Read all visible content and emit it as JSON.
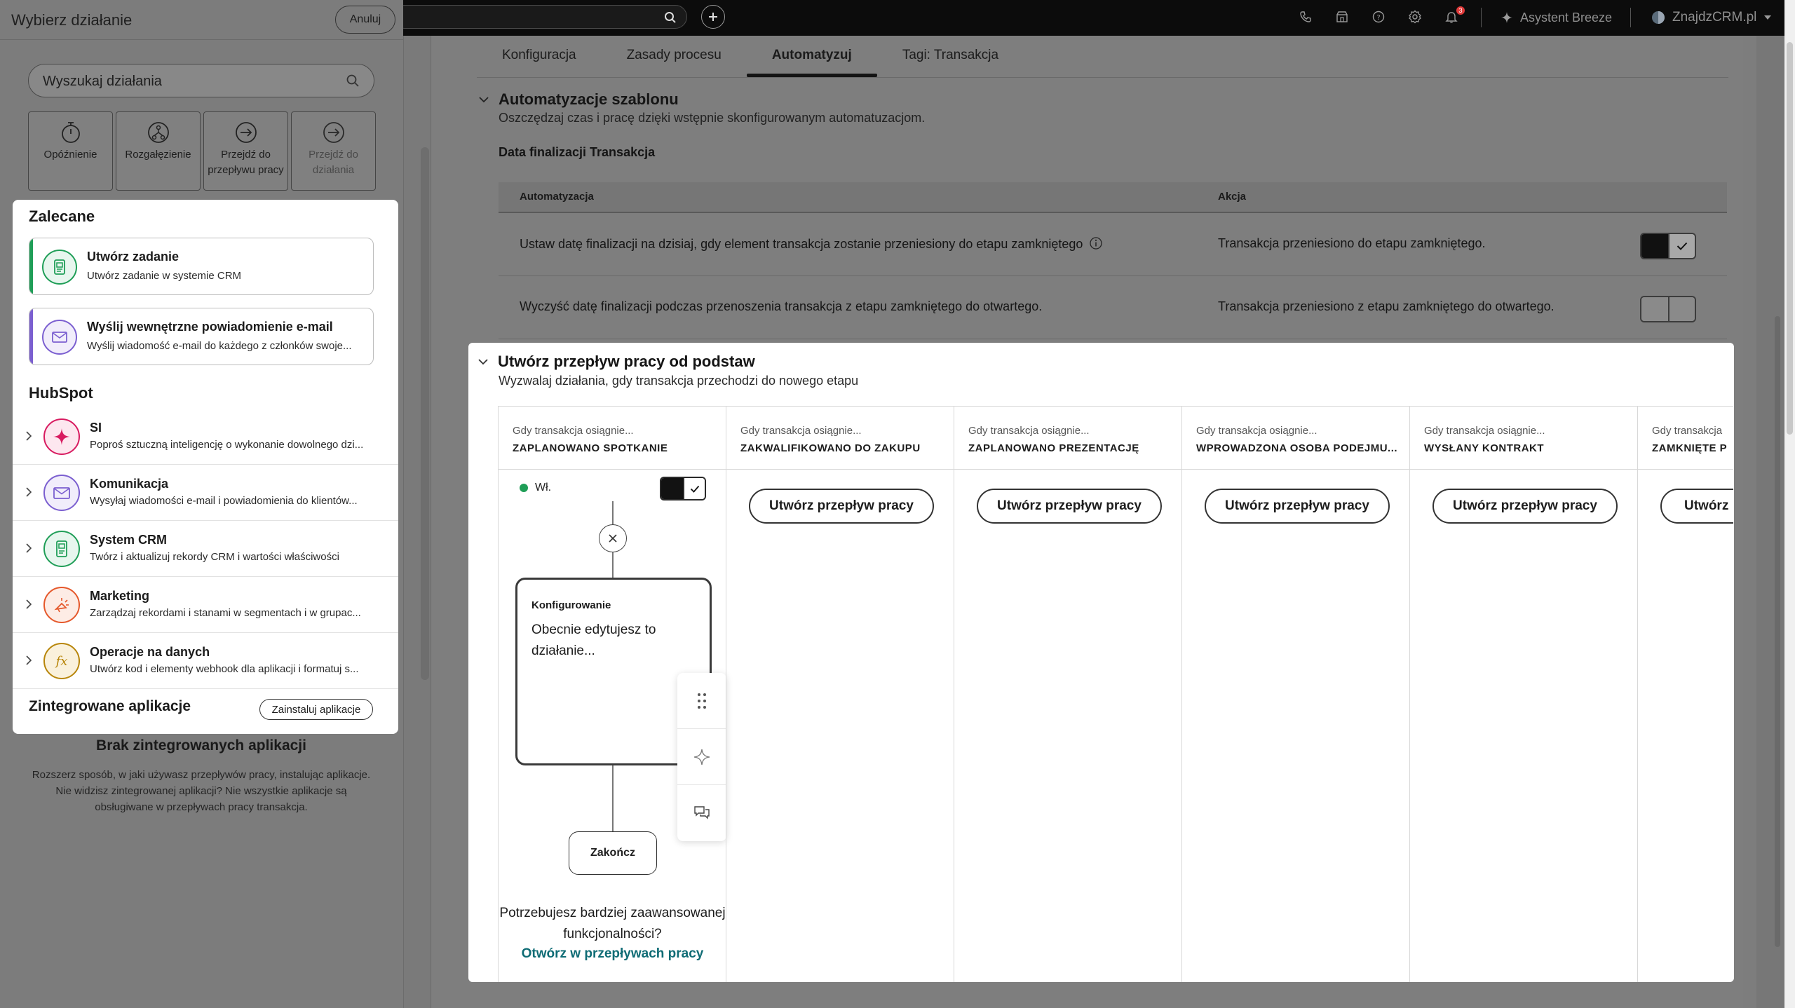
{
  "topbar": {
    "search_placeholder": "",
    "breeze_label": "Asystent Breeze",
    "account_label": "ZnajdzCRM.pl",
    "notifications_count": "3"
  },
  "tabs": [
    {
      "label": "Konfiguracja",
      "active": false
    },
    {
      "label": "Zasady procesu",
      "active": false
    },
    {
      "label": "Automatyzuj",
      "active": true
    },
    {
      "label": "Tagi: Transakcja",
      "active": false
    }
  ],
  "templates": {
    "title": "Automatyzacje szablonu",
    "subtitle": "Oszczędzaj czas i pracę dzięki wstępnie skonfigurowanym automatuzacjom.",
    "group_title": "Data finalizacji Transakcja",
    "col_automation": "Automatyzacja",
    "col_action": "Akcja",
    "rows": [
      {
        "automation": "Ustaw datę finalizacji na dzisiaj, gdy element transakcja zostanie przeniesiony do etapu zamkniętego",
        "action": "Transakcja przeniesiono do etapu zamkniętego.",
        "enabled": true
      },
      {
        "automation": "Wyczyść datę finalizacji podczas przenoszenia transakcja z etapu zamkniętego do otwartego.",
        "action": "Transakcja przeniesiono z etapu zamkniętego do otwartego.",
        "enabled": false
      }
    ]
  },
  "workflow": {
    "title": "Utwórz przepływ pracy od podstaw",
    "subtitle": "Wyzwalaj działania, gdy transakcja przechodzi do nowego etapu",
    "stages": [
      {
        "pre": "Gdy transakcja osiągnie...",
        "name": "ZAPLANOWANO SPOTKANIE"
      },
      {
        "pre": "Gdy transakcja osiągnie...",
        "name": "ZAKWALIFIKOWANO DO ZAKUPU"
      },
      {
        "pre": "Gdy transakcja osiągnie...",
        "name": "ZAPLANOWANO PREZENTACJĘ"
      },
      {
        "pre": "Gdy transakcja osiągnie...",
        "name": "WPROWADZONA OSOBA PODEJMU..."
      },
      {
        "pre": "Gdy transakcja osiągnie...",
        "name": "WYSŁANY KONTRAKT"
      },
      {
        "pre": "Gdy transakcja",
        "name": "ZAMKNIĘTE P"
      }
    ],
    "create_btn_label": "Utwórz przepływ pracy",
    "last_create_label": "Utwórz",
    "editor": {
      "status": "Wł.",
      "config_title": "Konfigurowanie",
      "config_text": "Obecnie edytujesz to działanie...",
      "end_label": "Zakończ",
      "advanced_text": "Potrzebujesz bardziej zaawansowanej funkcjonalności?",
      "advanced_link": "Otwórz w przepływach pracy"
    }
  },
  "picker": {
    "title": "Wybierz działanie",
    "cancel_label": "Anuluj",
    "search_placeholder": "Wyszukaj działania",
    "utilities": [
      {
        "label": "Opóźnienie",
        "icon": "stopwatch-icon",
        "disabled": false
      },
      {
        "label": "Rozgałęzienie",
        "icon": "branch-icon",
        "disabled": false
      },
      {
        "label": "Przejdź do przepływu pracy",
        "icon": "arrow-circle-icon",
        "disabled": false
      },
      {
        "label": "Przejdź do działania",
        "icon": "arrow-circle-icon",
        "disabled": true
      }
    ],
    "recommended_title": "Zalecane",
    "recommended": [
      {
        "title": "Utwórz zadanie",
        "desc": "Utwórz zadanie w systemie CRM",
        "color": "#1f9e57"
      },
      {
        "title": "Wyślij wewnętrzne powiadomienie e-mail",
        "desc": "Wyślij wiadomość e-mail do każdego z członków swoje...",
        "color": "#7b5fd0"
      }
    ],
    "hubspot_title": "HubSpot",
    "categories": [
      {
        "title": "SI",
        "desc": "Poproś sztuczną inteligencję o wykonanie dowolnego dzi...",
        "color": "#d81b60"
      },
      {
        "title": "Komunikacja",
        "desc": "Wysyłaj wiadomości e-mail i powiadomienia do klientów...",
        "color": "#7b5fd0"
      },
      {
        "title": "System CRM",
        "desc": "Twórz i aktualizuj rekordy CRM i wartości właściwości",
        "color": "#1f9e57"
      },
      {
        "title": "Marketing",
        "desc": "Zarządzaj rekordami i stanami w segmentach i w grupac...",
        "color": "#e5582b"
      },
      {
        "title": "Operacje na danych",
        "desc": "Utwórz kod i elementy webhook dla aplikacji i formatuj s...",
        "color": "#b8860b"
      }
    ],
    "integrated_title": "Zintegrowane aplikacje",
    "install_label": "Zainstaluj aplikacje",
    "no_apps_title": "Brak zintegrowanych aplikacji",
    "no_apps_text": "Rozszerz sposób, w jaki używasz przepływów pracy, instalując aplikacje. Nie widzisz zintegrowanej aplikacji? Nie wszystkie aplikacje są obsługiwane w przepływach pracy transakcja."
  }
}
